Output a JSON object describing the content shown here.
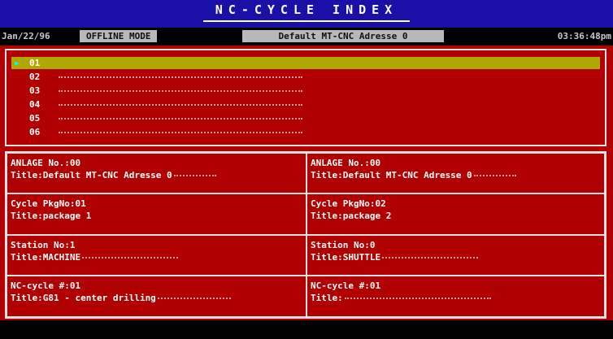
{
  "header": {
    "title": "NC-CYCLE INDEX"
  },
  "status": {
    "date": "Jan/22/96",
    "mode": "OFFLINE MODE",
    "address": "Default MT-CNC Adresse 0",
    "time": "03:36:48pm"
  },
  "list": {
    "items": [
      {
        "label": "01",
        "selected": true
      },
      {
        "label": "02"
      },
      {
        "label": "03"
      },
      {
        "label": "04"
      },
      {
        "label": "05"
      },
      {
        "label": "06"
      }
    ],
    "selection_glyph": "►"
  },
  "panels": {
    "left": {
      "anlage_label": "ANLAGE No.:00",
      "anlage_title": "Title:Default MT-CNC Adresse 0",
      "cycle_label": "Cycle PkgNo:01",
      "cycle_title": "Title:package 1",
      "station_label": "Station No:1",
      "station_title": "Title:MACHINE",
      "nc_label": "NC-cycle #:01",
      "nc_title": "Title:G81 - center drilling"
    },
    "right": {
      "anlage_label": "ANLAGE No.:00",
      "anlage_title": "Title:Default MT-CNC Adresse 0",
      "cycle_label": "Cycle PkgNo:02",
      "cycle_title": "Title:package 2",
      "station_label": "Station No:0",
      "station_title": "Title:SHUTTLE",
      "nc_label": "NC-cycle #:01",
      "nc_title": "Title:"
    }
  }
}
